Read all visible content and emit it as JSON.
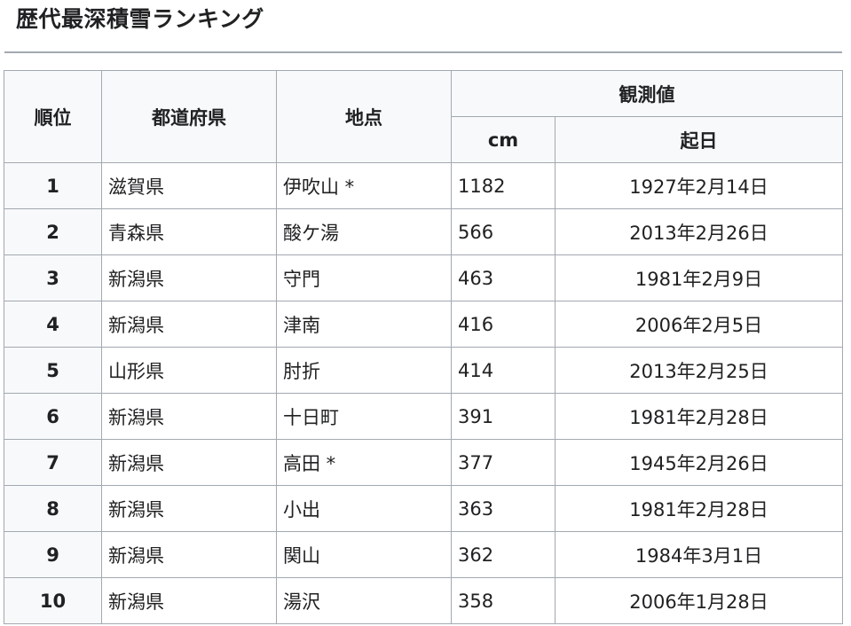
{
  "title": "歴代最深積雪ランキング",
  "table": {
    "headers": {
      "rank": "順位",
      "prefecture": "都道府県",
      "location": "地点",
      "observed": "観測値",
      "cm": "cm",
      "date": "起日"
    },
    "rows": [
      {
        "rank": "1",
        "prefecture": "滋賀県",
        "location": "伊吹山 *",
        "cm": "1182",
        "date": "1927年2月14日"
      },
      {
        "rank": "2",
        "prefecture": "青森県",
        "location": "酸ケ湯",
        "cm": "566",
        "date": "2013年2月26日"
      },
      {
        "rank": "3",
        "prefecture": "新潟県",
        "location": "守門",
        "cm": "463",
        "date": "1981年2月9日"
      },
      {
        "rank": "4",
        "prefecture": "新潟県",
        "location": "津南",
        "cm": "416",
        "date": "2006年2月5日"
      },
      {
        "rank": "5",
        "prefecture": "山形県",
        "location": "肘折",
        "cm": "414",
        "date": "2013年2月25日"
      },
      {
        "rank": "6",
        "prefecture": "新潟県",
        "location": "十日町",
        "cm": "391",
        "date": "1981年2月28日"
      },
      {
        "rank": "7",
        "prefecture": "新潟県",
        "location": "高田 *",
        "cm": "377",
        "date": "1945年2月26日"
      },
      {
        "rank": "8",
        "prefecture": "新潟県",
        "location": "小出",
        "cm": "363",
        "date": "1981年2月28日"
      },
      {
        "rank": "9",
        "prefecture": "新潟県",
        "location": "関山",
        "cm": "362",
        "date": "1984年3月1日"
      },
      {
        "rank": "10",
        "prefecture": "新潟県",
        "location": "湯沢",
        "cm": "358",
        "date": "2006年1月28日"
      }
    ]
  }
}
